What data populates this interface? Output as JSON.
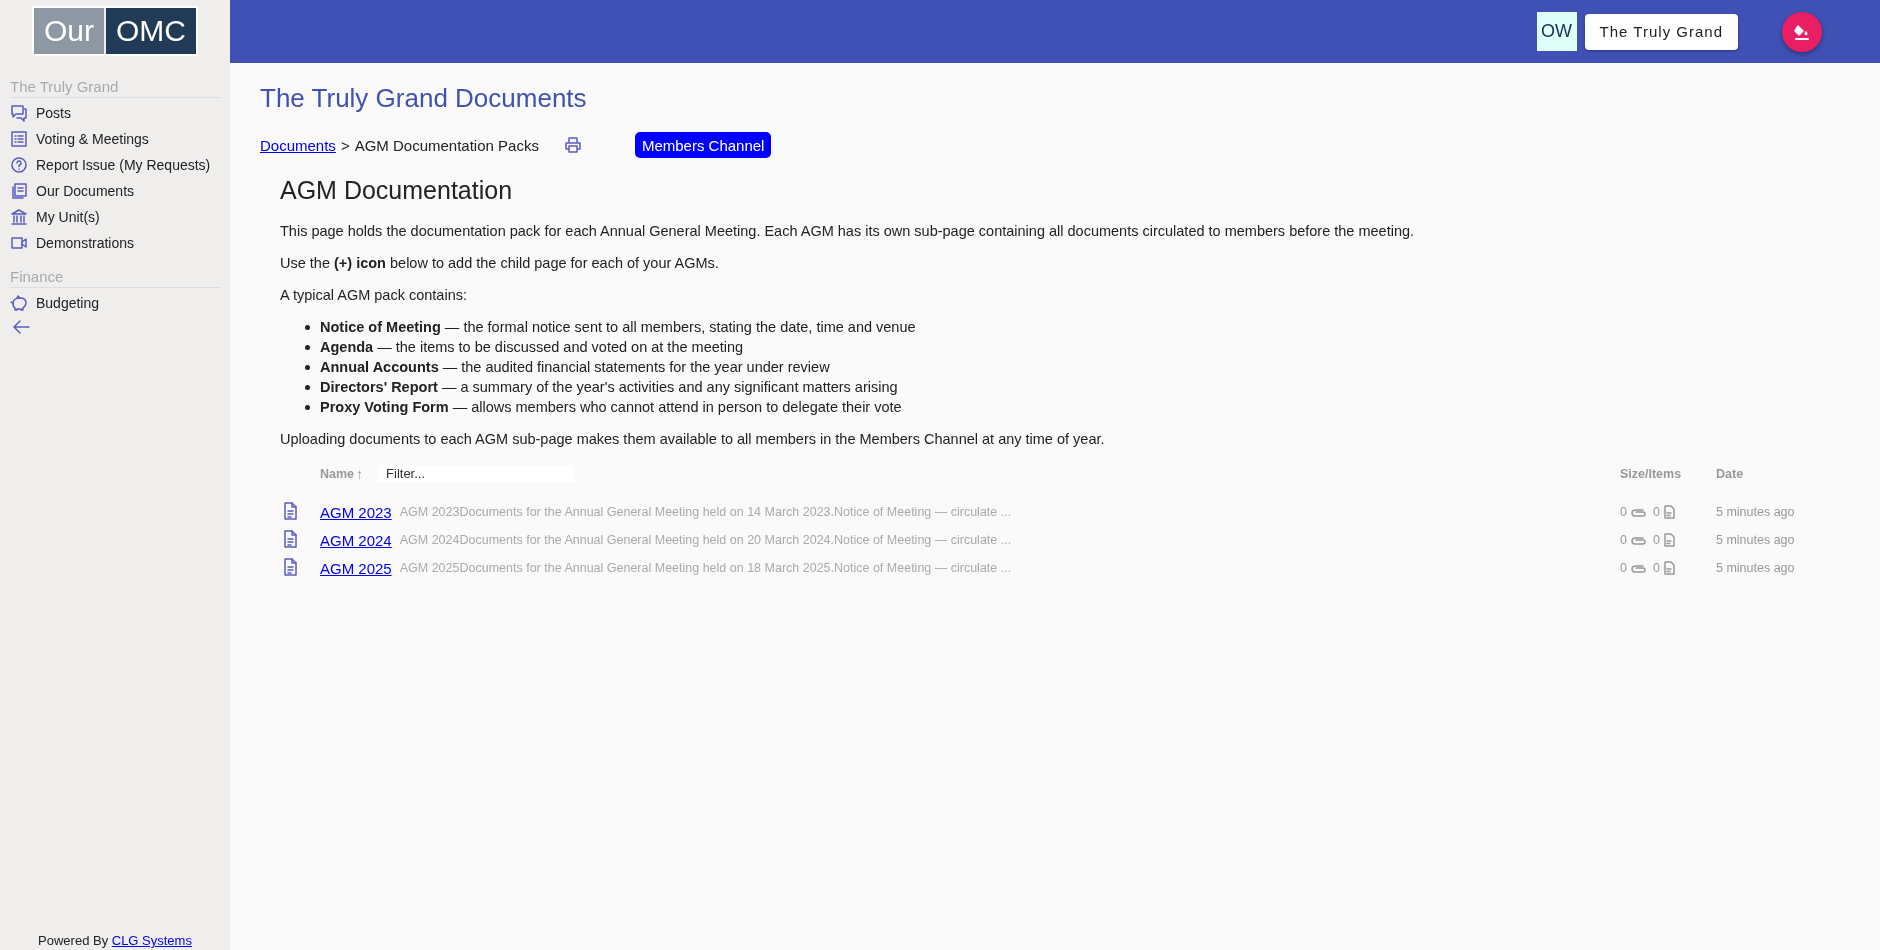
{
  "logo": {
    "part_1": "Our",
    "part_2": "OMC"
  },
  "sidebar": {
    "groups": [
      {
        "title": "The Truly Grand",
        "items": [
          {
            "label": "Posts"
          },
          {
            "label": "Voting & Meetings"
          },
          {
            "label": "Report Issue (My Requests)"
          },
          {
            "label": "Our Documents"
          },
          {
            "label": "My Unit(s)"
          },
          {
            "label": "Demonstrations"
          }
        ]
      },
      {
        "title": "Finance",
        "items": [
          {
            "label": "Budgeting"
          }
        ]
      }
    ],
    "footer": {
      "text": "Powered By",
      "link": "CLG Systems"
    }
  },
  "header": {
    "user_initials": "OW",
    "site_button": "The Truly Grand"
  },
  "page": {
    "title": "The Truly Grand Documents",
    "breadcrumb": {
      "link": "Documents",
      "separator": ">",
      "current": "AGM Documentation Packs"
    },
    "channel_button": "Members Channel",
    "heading": "AGM Documentation",
    "paragraphs_before": [
      "This page holds the documentation pack for each Annual General Meeting. Each AGM has its own sub-page containing all documents circulated to members before the meeting.",
      "Use the **(+) icon** below to add the child page for each of your AGMs.",
      "A typical AGM pack contains:"
    ],
    "list": [
      "**Notice of Meeting** — the formal notice sent to all members, stating the date, time and venue",
      "**Agenda** — the items to be discussed and voted on at the meeting",
      "**Annual Accounts** — the audited financial statements for the year under review",
      "**Directors' Report** — a summary of the year's activities and any significant matters arising",
      "**Proxy Voting Form** — allows members who cannot attend in person to delegate their vote"
    ],
    "paragraph_after": "Uploading documents to each AGM sub-page makes them available to all members in the Members Channel at any time of year."
  },
  "table": {
    "columns": [
      {
        "label": "Name",
        "sort_indicator": "↑"
      },
      {
        "label": "Size/Items"
      },
      {
        "label": "Date"
      }
    ],
    "filter": {
      "placeholder": "Filter..."
    },
    "rows": [
      {
        "name": "AGM 2023",
        "description": "AGM 2023Documents for the Annual General Meeting held on 14 March 2023.Notice of Meeting — circulate ...",
        "attachments": "0",
        "items": "0",
        "date": "5 minutes ago"
      },
      {
        "name": "AGM 2024",
        "description": "AGM 2024Documents for the Annual General Meeting held on 20 March 2024.Notice of Meeting — circulate ...",
        "attachments": "0",
        "items": "0",
        "date": "5 minutes ago"
      },
      {
        "name": "AGM 2025",
        "description": "AGM 2025Documents for the Annual General Meeting held on 18 March 2025.Notice of Meeting — circulate ...",
        "attachments": "0",
        "items": "0",
        "date": "5 minutes ago"
      }
    ]
  }
}
